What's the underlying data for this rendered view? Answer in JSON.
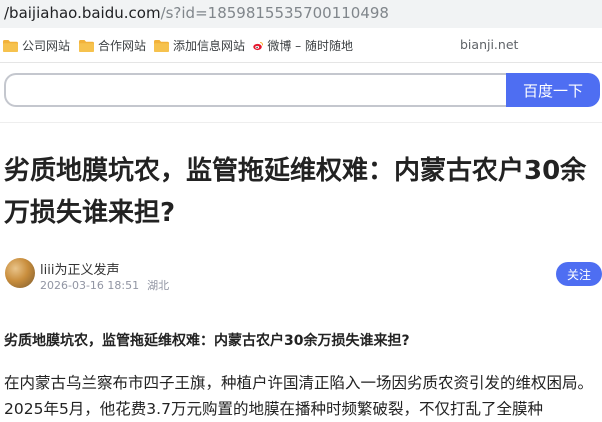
{
  "browser": {
    "url_host": "/baijiahao.baidu.com",
    "url_path": "/s?id=1859815535700110498"
  },
  "bookmarks": [
    {
      "label": "公司网站",
      "icon": "folder-icon"
    },
    {
      "label": "合作网站",
      "icon": "folder-icon"
    },
    {
      "label": "添加信息网站",
      "icon": "folder-icon"
    },
    {
      "label": "微博 – 随时随地",
      "icon": "weibo-icon"
    }
  ],
  "watermark": "bianji.net",
  "search": {
    "value": "",
    "button_label": "百度一下"
  },
  "article": {
    "title": "劣质地膜坑农，监管拖延维权难：内蒙古农户30余万损失谁来担?",
    "author": "liii为正义发声",
    "datetime": "2026-03-16 18:51",
    "location": "湖北",
    "follow_label": "关注",
    "subheading": "劣质地膜坑农，监管拖延维权难：内蒙古农户30余万损失谁来担?",
    "body": "在内蒙古乌兰察布市四子王旗，种植户许国清正陷入一场因劣质农资引发的维权困局。2025年5月，他花费3.7万元购置的地膜在播种时频繁破裂，不仅打乱了全膜种"
  },
  "colors": {
    "accent": "#4e6ef2",
    "folder": "#f2b23a"
  }
}
